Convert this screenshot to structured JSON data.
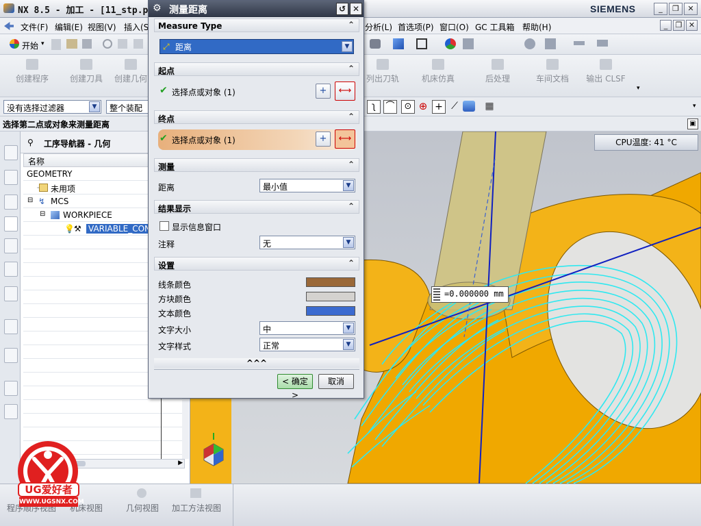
{
  "window": {
    "title": "NX 8.5 - 加工 - [11_stp.p",
    "brand": "SIEMENS",
    "buttons": [
      "_",
      "❐",
      "✕"
    ]
  },
  "menubar": {
    "left_items": [
      "文件(F)",
      "编辑(E)",
      "视图(V)",
      "插入(S"
    ],
    "right_items": [
      "分析(L)",
      "首选项(P)",
      "窗口(O)",
      "GC 工具箱",
      "帮助(H)"
    ]
  },
  "toolbar1": {
    "start_label": "开始"
  },
  "toolbar2": {
    "buttons": [
      "创建程序",
      "创建刀具",
      "创建几何",
      "列出刀轨",
      "机床仿真",
      "后处理",
      "车间文档",
      "输出 CLSF"
    ]
  },
  "filter": {
    "type_filter": "没有选择过滤器",
    "scope": "整个装配"
  },
  "status": {
    "prompt": "选择第二点或对象来测量距离"
  },
  "navigator": {
    "title": "工序导航器 - 几何",
    "column_header": "名称",
    "rows": [
      {
        "label": "GEOMETRY"
      },
      {
        "label": "未用项"
      },
      {
        "label": "MCS"
      },
      {
        "label": "WORKPIECE"
      },
      {
        "label": "VARIABLE_CON"
      }
    ]
  },
  "bottom_views": [
    "程序顺序视图",
    "机床视图",
    "几何视图",
    "加工方法视图"
  ],
  "graphics": {
    "cpu_temp": "CPU温度: 41 °C",
    "measure_readout": "=0.000000 mm"
  },
  "watermark": {
    "logo_text": "UG爱好者",
    "url": "WWW.UGSNX.COM"
  },
  "dialog": {
    "title": "测量距离",
    "title_buttons": [
      "↺",
      "✕"
    ],
    "sections": {
      "measure_type": {
        "header": "Measure Type",
        "value": "距离"
      },
      "start_point": {
        "header": "起点",
        "select_label": "选择点或对象 (1)"
      },
      "end_point": {
        "header": "终点",
        "select_label": "选择点或对象 (1)"
      },
      "measure": {
        "header": "测量",
        "distance_label": "距离",
        "distance_value": "最小值"
      },
      "results": {
        "header": "结果显示",
        "show_info_label": "显示信息窗口",
        "annotation_label": "注释",
        "annotation_value": "无"
      },
      "settings": {
        "header": "设置",
        "line_color_label": "线条颜色",
        "line_color": "#9a6838",
        "block_color_label": "方块颜色",
        "block_color": "#d4d2cf",
        "text_color_label": "文本颜色",
        "text_color": "#3b6bd0",
        "text_size_label": "文字大小",
        "text_size_value": "中",
        "text_style_label": "文字样式",
        "text_style_value": "正常"
      }
    },
    "more_label": "^^^",
    "ok_label": "< 确定 >",
    "cancel_label": "取消"
  }
}
